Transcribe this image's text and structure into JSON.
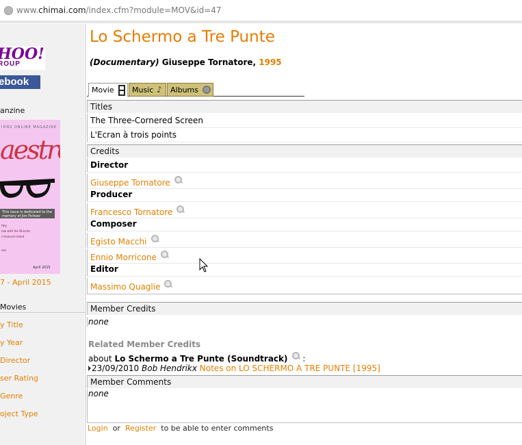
{
  "browser": {
    "url_prefix": "www.",
    "url_domain": "chimai.com",
    "url_path": "/index.cfm?module=MOV&id=47"
  },
  "sidebar": {
    "yahoo_text": "HOO!",
    "yahoo_sub": "ROUP",
    "facebook_text": "ebook",
    "fanzine_label": "anzine",
    "magazine": {
      "header": "IONS ONLINE MAGAZINE",
      "title_script": "aestro",
      "dedication": "This issue is dedicated to the memory of Jim Ficheer",
      "lines": [
        "ttey",
        "rew with the Director",
        "s treasure island",
        "nes"
      ],
      "cover_date": "April 2015"
    },
    "issue_link": "7 - April 2015",
    "movies_heading": "Movies",
    "links": [
      "y Title",
      "y Year",
      "Director",
      "ser Rating",
      "Genre",
      "oject Type"
    ]
  },
  "movie": {
    "title": "Lo Schermo a Tre Punte",
    "genre": "(Documentary)",
    "director_name": "Giuseppe Tornatore,",
    "year": "1995"
  },
  "tabs": [
    {
      "label": "Movie"
    },
    {
      "label": "Music"
    },
    {
      "label": "Albums"
    }
  ],
  "titles": {
    "heading": "Titles",
    "items": [
      "The Three-Cornered Screen",
      "L'Ecran à trois points"
    ]
  },
  "credits": {
    "heading": "Credits",
    "director_role": "Director",
    "director": "Giuseppe Tornatore",
    "producer_role": "Producer",
    "producer": "Francesco Tornatore",
    "composer_role": "Composer",
    "composer_1": "Egisto Macchi",
    "composer_2": "Ennio Morricone",
    "editor_role": "Editor",
    "editor": "Massimo Quaglie"
  },
  "member_credits": {
    "heading": "Member Credits",
    "value": "none"
  },
  "related": {
    "heading": "Related Member Credits",
    "about_prefix": "about",
    "about_title": "Lo Schermo a Tre Punte (Soundtrack)",
    "about_suffix": ":",
    "date": "23/09/2010",
    "member": "Bob Hendrikx",
    "notes_link": "Notes on LO SCHERMO A TRE PUNTE [1995]"
  },
  "member_comments": {
    "heading": "Member Comments",
    "value": "none"
  },
  "footer": {
    "login": "Login",
    "or": "or",
    "register": "Register",
    "suffix": "to be able to enter comments"
  }
}
